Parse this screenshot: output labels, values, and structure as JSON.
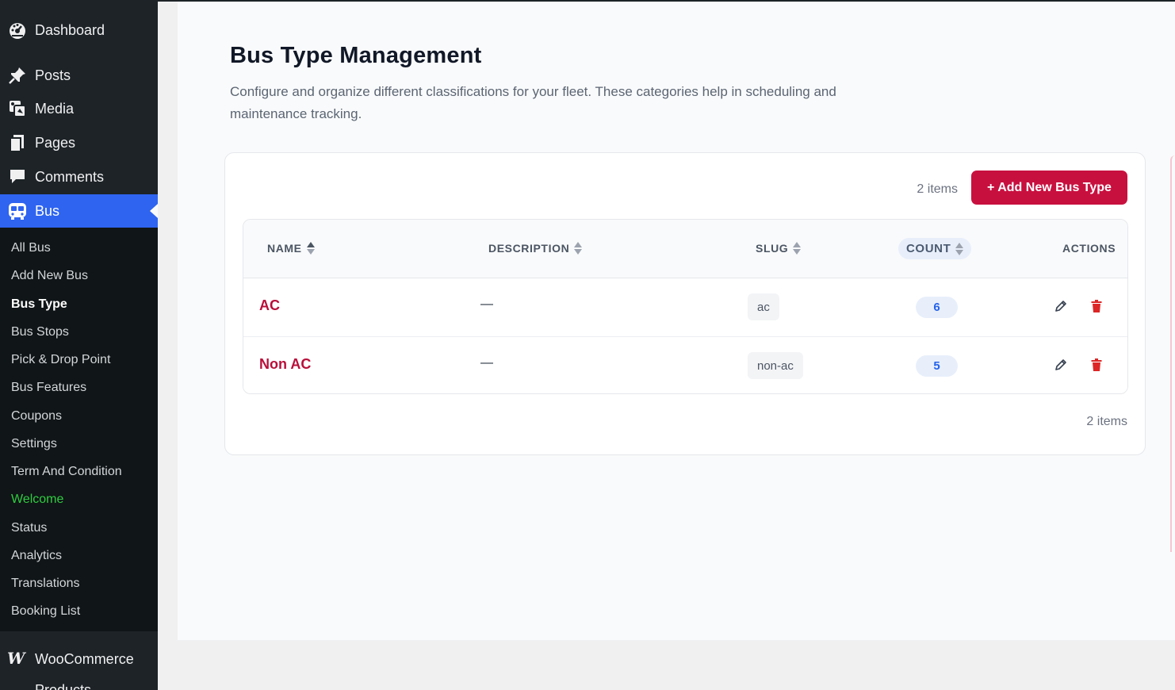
{
  "sidebar": {
    "top_items": [
      {
        "label": "Dashboard",
        "icon": "dashboard-icon"
      },
      {
        "label": "Posts",
        "icon": "pin-icon"
      },
      {
        "label": "Media",
        "icon": "media-icon"
      },
      {
        "label": "Pages",
        "icon": "pages-icon"
      },
      {
        "label": "Comments",
        "icon": "comment-icon"
      },
      {
        "label": "Bus",
        "icon": "bus-icon"
      }
    ],
    "submenu": [
      "All Bus",
      "Add New Bus",
      "Bus Type",
      "Bus Stops",
      "Pick & Drop Point",
      "Bus Features",
      "Coupons",
      "Settings",
      "Term And Condition",
      "Welcome",
      "Status",
      "Analytics",
      "Translations",
      "Booking List"
    ],
    "current_submenu": "Bus Type",
    "woocommerce": {
      "label": "WooCommerce",
      "icon": "woocommerce-icon",
      "glyph": "W"
    },
    "next_item_peek": "Products"
  },
  "page": {
    "title": "Bus Type Management",
    "description": "Configure and organize different classifications for your fleet. These categories help in scheduling and maintenance tracking."
  },
  "toolbar": {
    "items_count": "2 items",
    "add_button": "+ Add New Bus Type"
  },
  "table": {
    "columns": [
      "NAME",
      "DESCRIPTION",
      "SLUG",
      "COUNT",
      "ACTIONS"
    ],
    "rows": [
      {
        "name": "AC",
        "description": "—",
        "slug": "ac",
        "count": "6"
      },
      {
        "name": "Non AC",
        "description": "—",
        "slug": "non-ac",
        "count": "5"
      }
    ]
  },
  "footer": {
    "items_count": "2 items"
  },
  "colors": {
    "sidebar_bg": "#1d2327",
    "active_menu": "#2e64f0",
    "accent_red": "#c8103f",
    "count_blue": "#2563eb",
    "welcome_green": "#2ecc40"
  }
}
